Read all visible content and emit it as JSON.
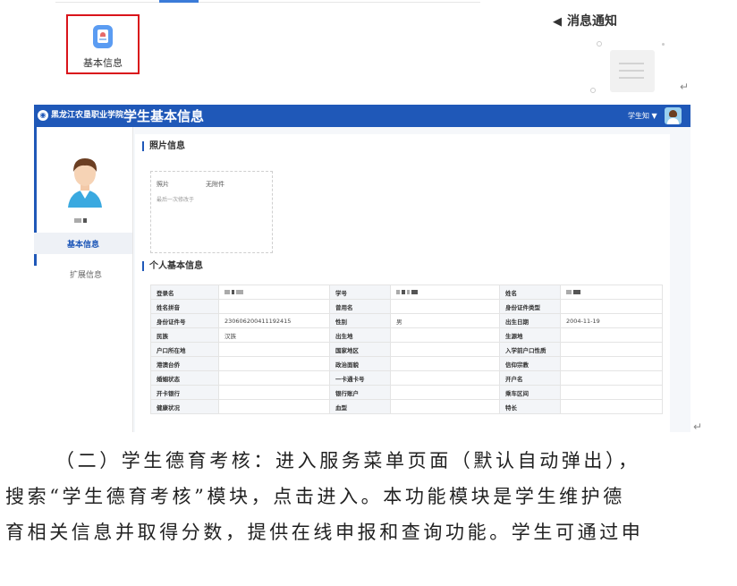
{
  "top": {
    "tile_label": "基本信息",
    "notice_title": "消息通知",
    "return_mark": "↵"
  },
  "app": {
    "title": "学生基本信息",
    "user_label": "学生知 ▼",
    "sidebar": {
      "menu": [
        "基本信息",
        "扩展信息"
      ]
    },
    "photo_section": {
      "title": "照片信息",
      "photo_label": "照片",
      "photo_value": "无附件",
      "last_modified": "最后一次修改于"
    },
    "personal_section": {
      "title": "个人基本信息",
      "rows": [
        [
          "登录名",
          "",
          "学号",
          "",
          "姓名",
          ""
        ],
        [
          "姓名拼音",
          "",
          "曾用名",
          "",
          "身份证件类型",
          ""
        ],
        [
          "身份证件号",
          "230606200411192415",
          "性别",
          "男",
          "出生日期",
          "2004-11-19"
        ],
        [
          "民族",
          "汉族",
          "出生地",
          "",
          "生源地",
          ""
        ],
        [
          "户口所在地",
          "",
          "国家地区",
          "",
          "入学前户口性质",
          ""
        ],
        [
          "港澳台侨",
          "",
          "政治面貌",
          "",
          "信仰宗教",
          ""
        ],
        [
          "婚姻状态",
          "",
          "一卡通卡号",
          "",
          "开户名",
          ""
        ],
        [
          "开卡银行",
          "",
          "银行账户",
          "",
          "乘车区间",
          ""
        ],
        [
          "健康状况",
          "",
          "血型",
          "",
          "特长",
          ""
        ]
      ]
    }
  },
  "paragraph": [
    "（二）学生德育考核：进入服务菜单页面（默认自动弹出），",
    "搜索“学生德育考核”模块，点击进入。本功能模块是学生维护德",
    "育相关信息并取得分数，提供在线申报和查询功能。学生可通过申"
  ]
}
